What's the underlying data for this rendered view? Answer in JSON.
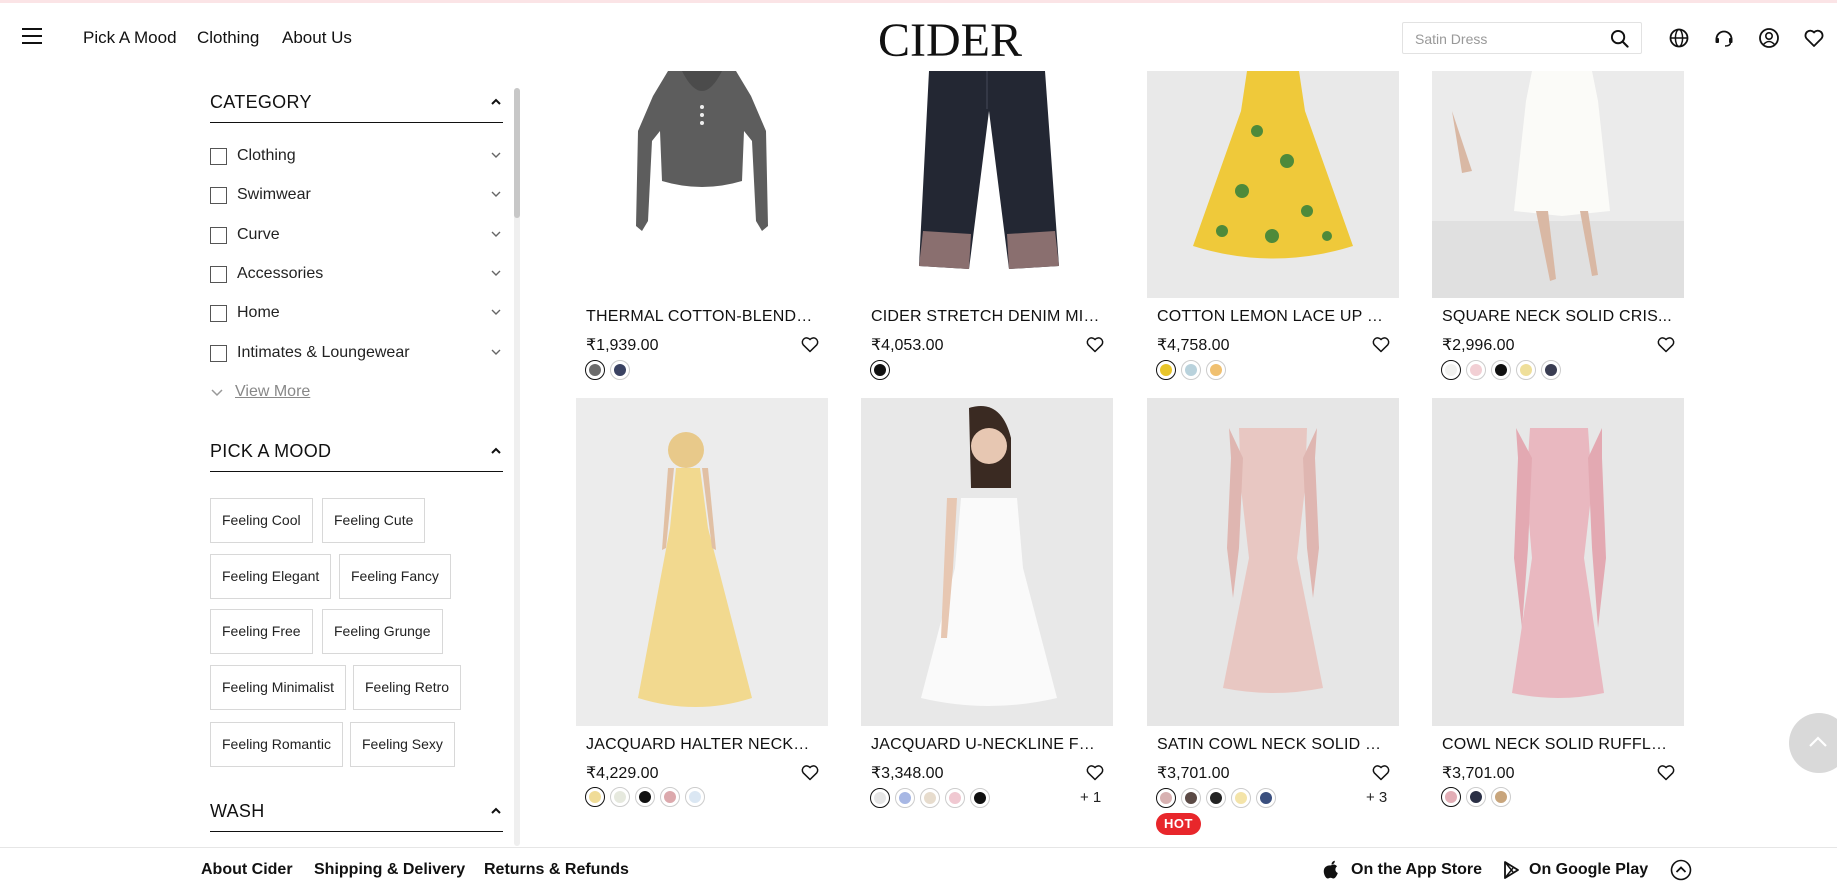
{
  "header": {
    "nav": [
      "Pick A Mood",
      "Clothing",
      "About Us"
    ],
    "logo": "CIDER",
    "search_placeholder": "Satin Dress",
    "icons": [
      "globe-icon",
      "support-icon",
      "account-icon",
      "heart-icon"
    ]
  },
  "sidebar": {
    "category_title": "CATEGORY",
    "categories": [
      "Clothing",
      "Swimwear",
      "Curve",
      "Accessories",
      "Home",
      "Intimates & Loungewear"
    ],
    "view_more": "View More",
    "mood_title": "PICK A MOOD",
    "moods": [
      "Feeling Cool",
      "Feeling Cute",
      "Feeling Elegant",
      "Feeling Fancy",
      "Feeling Free",
      "Feeling Grunge",
      "Feeling Minimalist",
      "Feeling Retro",
      "Feeling Romantic",
      "Feeling Sexy"
    ],
    "wash_title": "WASH"
  },
  "products": [
    {
      "name": "THERMAL COTTON-BLEND V...",
      "price": "₹1,939.00",
      "swatches": [
        "#6b6b6b",
        "#3a4262"
      ],
      "more": "",
      "hot": ""
    },
    {
      "name": "CIDER STRETCH DENIM MID...",
      "price": "₹4,053.00",
      "swatches": [
        "#111111"
      ],
      "more": "",
      "hot": ""
    },
    {
      "name": "COTTON LEMON LACE UP P...",
      "price": "₹4,758.00",
      "swatches": [
        "#e8c52a",
        "#b9d2dc",
        "#f0c070"
      ],
      "more": "",
      "hot": ""
    },
    {
      "name": "SQUARE NECK SOLID CRIS...",
      "price": "₹2,996.00",
      "swatches": [
        "#f1f1ef",
        "#f2cfd4",
        "#111111",
        "#efdf9a",
        "#3a3d52"
      ],
      "more": "",
      "hot": ""
    },
    {
      "name": "JACQUARD HALTER NECKLI...",
      "price": "₹4,229.00",
      "swatches": [
        "#f0dc98",
        "#e6e9de",
        "#111111",
        "#dca9ad",
        "#dbe7f3"
      ],
      "more": "",
      "hot": ""
    },
    {
      "name": "JACQUARD U-NECKLINE FL...",
      "price": "₹3,348.00",
      "swatches": [
        "#e6e6e6",
        "#a7b7e4",
        "#e7dccd",
        "#f0c8d1",
        "#111111"
      ],
      "more": "+ 1",
      "hot": ""
    },
    {
      "name": "SATIN COWL NECK SOLID R...",
      "price": "₹3,701.00",
      "swatches": [
        "#d8b2b2",
        "#5b4a45",
        "#222222",
        "#f4e4a9",
        "#3a4f7e"
      ],
      "more": "+ 3",
      "hot": "HOT"
    },
    {
      "name": "COWL NECK SOLID RUFFLE ...",
      "price": "₹3,701.00",
      "swatches": [
        "#e2aeb6",
        "#2a2f45",
        "#c8a57c"
      ],
      "more": "",
      "hot": ""
    }
  ],
  "footer": {
    "links": [
      "About Cider",
      "Shipping & Delivery",
      "Returns & Refunds"
    ],
    "app_store": "On the App Store",
    "google_play": "On Google Play"
  },
  "colors": {
    "accent_hot": "#e8262b",
    "topline": "#fbe4e6"
  }
}
